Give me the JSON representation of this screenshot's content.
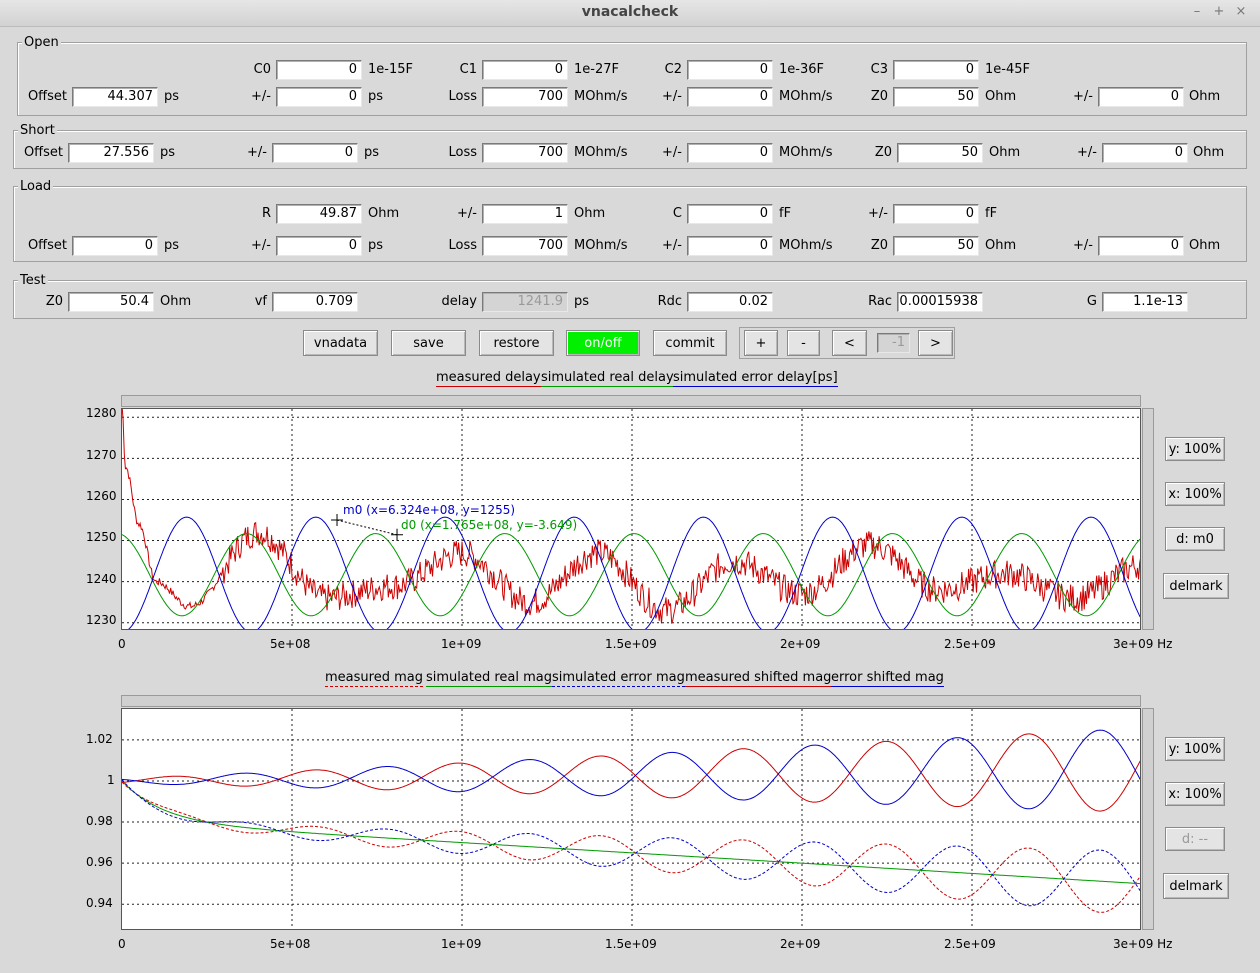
{
  "window": {
    "title": "vnacalcheck",
    "min": "–",
    "max": "+",
    "close": "×"
  },
  "open": {
    "title": "Open",
    "c0_label": "C0",
    "c0_value": "0",
    "c0_unit": "1e-15F",
    "c1_label": "C1",
    "c1_value": "0",
    "c1_unit": "1e-27F",
    "c2_label": "C2",
    "c2_value": "0",
    "c2_unit": "1e-36F",
    "c3_label": "C3",
    "c3_value": "0",
    "c3_unit": "1e-45F",
    "offset_label": "Offset",
    "offset_value": "44.307",
    "offset_unit": "ps",
    "pm1_label": "+/-",
    "pm1_value": "0",
    "pm1_unit": "ps",
    "loss_label": "Loss",
    "loss_value": "700",
    "loss_unit": "MOhm/s",
    "pm2_label": "+/-",
    "pm2_value": "0",
    "pm2_unit": "MOhm/s",
    "z0_label": "Z0",
    "z0_value": "50",
    "z0_unit": "Ohm",
    "pm3_label": "+/-",
    "pm3_value": "0",
    "pm3_unit": "Ohm"
  },
  "short": {
    "title": "Short",
    "offset_label": "Offset",
    "offset_value": "27.556",
    "offset_unit": "ps",
    "pm1_label": "+/-",
    "pm1_value": "0",
    "pm1_unit": "ps",
    "loss_label": "Loss",
    "loss_value": "700",
    "loss_unit": "MOhm/s",
    "pm2_label": "+/-",
    "pm2_value": "0",
    "pm2_unit": "MOhm/s",
    "z0_label": "Z0",
    "z0_value": "50",
    "z0_unit": "Ohm",
    "pm3_label": "+/-",
    "pm3_value": "0",
    "pm3_unit": "Ohm"
  },
  "load": {
    "title": "Load",
    "r_label": "R",
    "r_value": "49.87",
    "r_unit": "Ohm",
    "pmr_label": "+/-",
    "pmr_value": "1",
    "pmr_unit": "Ohm",
    "c_label": "C",
    "c_value": "0",
    "c_unit": "fF",
    "pmc_label": "+/-",
    "pmc_value": "0",
    "pmc_unit": "fF",
    "offset_label": "Offset",
    "offset_value": "0",
    "offset_unit": "ps",
    "pm1_label": "+/-",
    "pm1_value": "0",
    "pm1_unit": "ps",
    "loss_label": "Loss",
    "loss_value": "700",
    "loss_unit": "MOhm/s",
    "pm2_label": "+/-",
    "pm2_value": "0",
    "pm2_unit": "MOhm/s",
    "z0_label": "Z0",
    "z0_value": "50",
    "z0_unit": "Ohm",
    "pm3_label": "+/-",
    "pm3_value": "0",
    "pm3_unit": "Ohm"
  },
  "test": {
    "title": "Test",
    "z0_label": "Z0",
    "z0_value": "50.4",
    "z0_unit": "Ohm",
    "vf_label": "vf",
    "vf_value": "0.709",
    "delay_label": "delay",
    "delay_value": "1241.9",
    "delay_unit": "ps",
    "rdc_label": "Rdc",
    "rdc_value": "0.02",
    "rac_label": "Rac",
    "rac_value": "0.00015938",
    "g_label": "G",
    "g_value": "1.1e-13"
  },
  "toolbar": {
    "vnadata": "vnadata",
    "save": "save",
    "restore": "restore",
    "onoff": "on/off",
    "commit": "commit",
    "plus": "+",
    "minus": "-",
    "prev": "<",
    "index": "-1",
    "next": ">"
  },
  "colors": {
    "red": "#cc0000",
    "green": "#009900",
    "blue": "#0000cc",
    "onoff": "#00f000"
  },
  "chart1": {
    "legend": [
      "measured delay",
      "simulated real delay",
      "simulated error delay[ps]"
    ],
    "xticks": [
      "0",
      "5e+08",
      "1e+09",
      "1.5e+09",
      "2e+09",
      "2.5e+09",
      "3e+09 Hz"
    ],
    "yticks": [
      "1280",
      "1270",
      "1260",
      "1250",
      "1240",
      "1230"
    ],
    "marker_m0": "m0 (x=6.324e+08, y=1255)",
    "marker_d0": "d0 (x=1.765e+08, y=-3.649)",
    "btn_y": "y: 100%",
    "btn_x": "x: 100%",
    "btn_d": "d: m0",
    "btn_del": "delmark"
  },
  "chart2": {
    "legend": [
      "measured mag",
      "simulated real mag",
      "simulated error mag",
      "measured shifted mag",
      "error shifted mag"
    ],
    "xticks": [
      "0",
      "5e+08",
      "1e+09",
      "1.5e+09",
      "2e+09",
      "2.5e+09",
      "3e+09 Hz"
    ],
    "yticks": [
      "1.02",
      "1",
      "0.98",
      "0.96",
      "0.94"
    ],
    "btn_y": "y: 100%",
    "btn_x": "x: 100%",
    "btn_d": "d: --",
    "btn_del": "delmark"
  },
  "chart_data": [
    {
      "type": "line",
      "xlabel": "Hz",
      "xlim": [
        0,
        3000000000
      ],
      "ylim": [
        1228,
        1282
      ],
      "series": [
        {
          "name": "measured delay",
          "color": "#cc0000",
          "style": "noisy",
          "x": [
            0,
            10000000,
            50000000,
            100000000,
            200000000,
            400000000,
            600000000,
            800000000,
            1000000000,
            1200000000,
            1400000000,
            1600000000,
            1800000000,
            2000000000,
            2200000000,
            2400000000,
            2600000000,
            2800000000,
            3000000000
          ],
          "y": [
            1283,
            1268,
            1254,
            1240,
            1234,
            1252,
            1236,
            1239,
            1247,
            1235,
            1247,
            1233,
            1245,
            1237,
            1249,
            1238,
            1242,
            1236,
            1244
          ]
        },
        {
          "name": "simulated real delay",
          "color": "#009900",
          "center": 1241.7,
          "amp": 10,
          "period": 380000000,
          "phase": 1.8
        },
        {
          "name": "simulated error delay[ps]",
          "color": "#0000cc",
          "center": 1241.7,
          "amp": 14,
          "period": 380000000,
          "phase": -1.57
        }
      ],
      "markers": [
        {
          "name": "m0",
          "x": 632400000,
          "y": 1255
        },
        {
          "name": "d0",
          "x": 808900000,
          "y": 1251.4
        }
      ]
    },
    {
      "type": "line",
      "xlabel": "Hz",
      "xlim": [
        0,
        3000000000
      ],
      "ylim": [
        0.927,
        1.035
      ],
      "series": [
        {
          "name": "measured mag",
          "color": "#cc0000",
          "dashed": true,
          "kind": "base",
          "sign": 1
        },
        {
          "name": "simulated real mag",
          "color": "#009900",
          "dashed": false,
          "kind": "base",
          "sign": 0
        },
        {
          "name": "simulated error mag",
          "color": "#0000cc",
          "dashed": true,
          "kind": "base",
          "sign": -1
        },
        {
          "name": "measured shifted mag",
          "color": "#cc0000",
          "dashed": false,
          "kind": "shift",
          "sign": 1
        },
        {
          "name": "error shifted mag",
          "color": "#0000cc",
          "dashed": false,
          "kind": "shift",
          "sign": -1
        }
      ]
    }
  ]
}
